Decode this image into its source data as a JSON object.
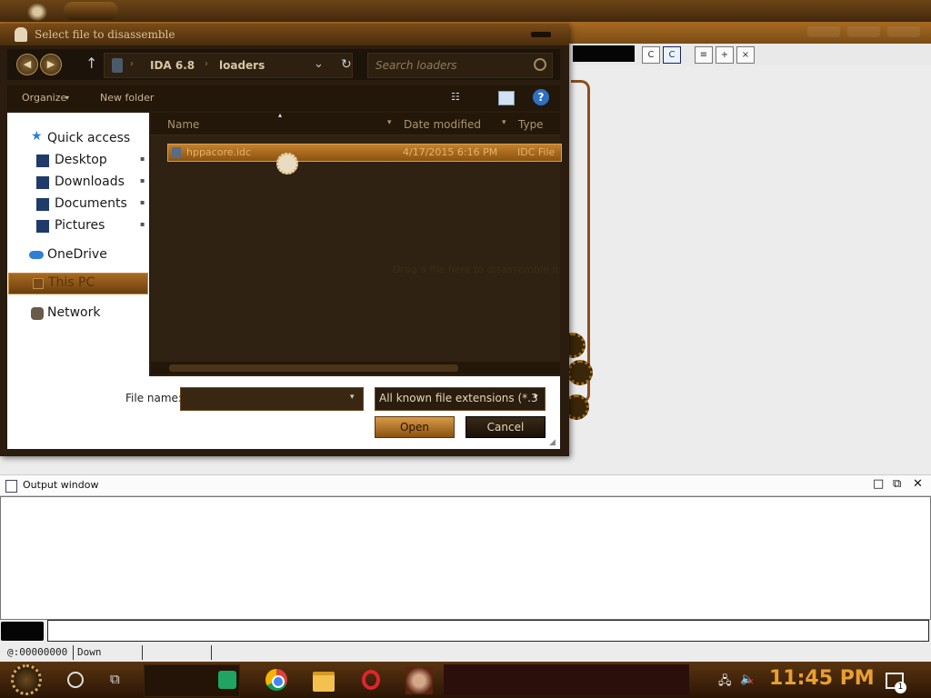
{
  "dialog": {
    "title": "Select file to disassemble",
    "address": [
      "IDA 6.8",
      "loaders"
    ],
    "search_placeholder": "Search loaders",
    "commands": {
      "organize": "Organize",
      "new_folder": "New folder"
    },
    "nav_items": [
      {
        "label": "Quick access",
        "icon": "star-icon"
      },
      {
        "label": "Desktop",
        "icon": "desktop-icon"
      },
      {
        "label": "Downloads",
        "icon": "downloads-icon"
      },
      {
        "label": "Documents",
        "icon": "documents-icon"
      },
      {
        "label": "Pictures",
        "icon": "pictures-icon"
      },
      {
        "label": "OneDrive",
        "icon": "cloud-icon"
      },
      {
        "label": "This PC",
        "icon": "computer-icon",
        "selected": true
      },
      {
        "label": "Network",
        "icon": "network-icon"
      }
    ],
    "columns": {
      "name": "Name",
      "date": "Date modified",
      "type": "Type"
    },
    "files": [
      {
        "name": "hppacore.idc",
        "date": "4/17/2015 6:16 PM",
        "type": "IDC File",
        "selected": true
      }
    ],
    "drop_hint": "Drag a file here to disassemble it",
    "file_name_label": "File name:",
    "file_name_value": "",
    "filter": "All known file extensions (*.3",
    "open_label": "Open",
    "cancel_label": "Cancel"
  },
  "output_window": {
    "title": "Output window",
    "command_value": ""
  },
  "status": {
    "address": "@:00000000",
    "direction": "Down"
  },
  "taskbar": {
    "apps": [
      "sheets-icon",
      "chrome-icon",
      "file-explorer-icon",
      "opera-icon",
      "portrait-icon"
    ],
    "clock": "11:45 PM",
    "notifications": "1"
  }
}
